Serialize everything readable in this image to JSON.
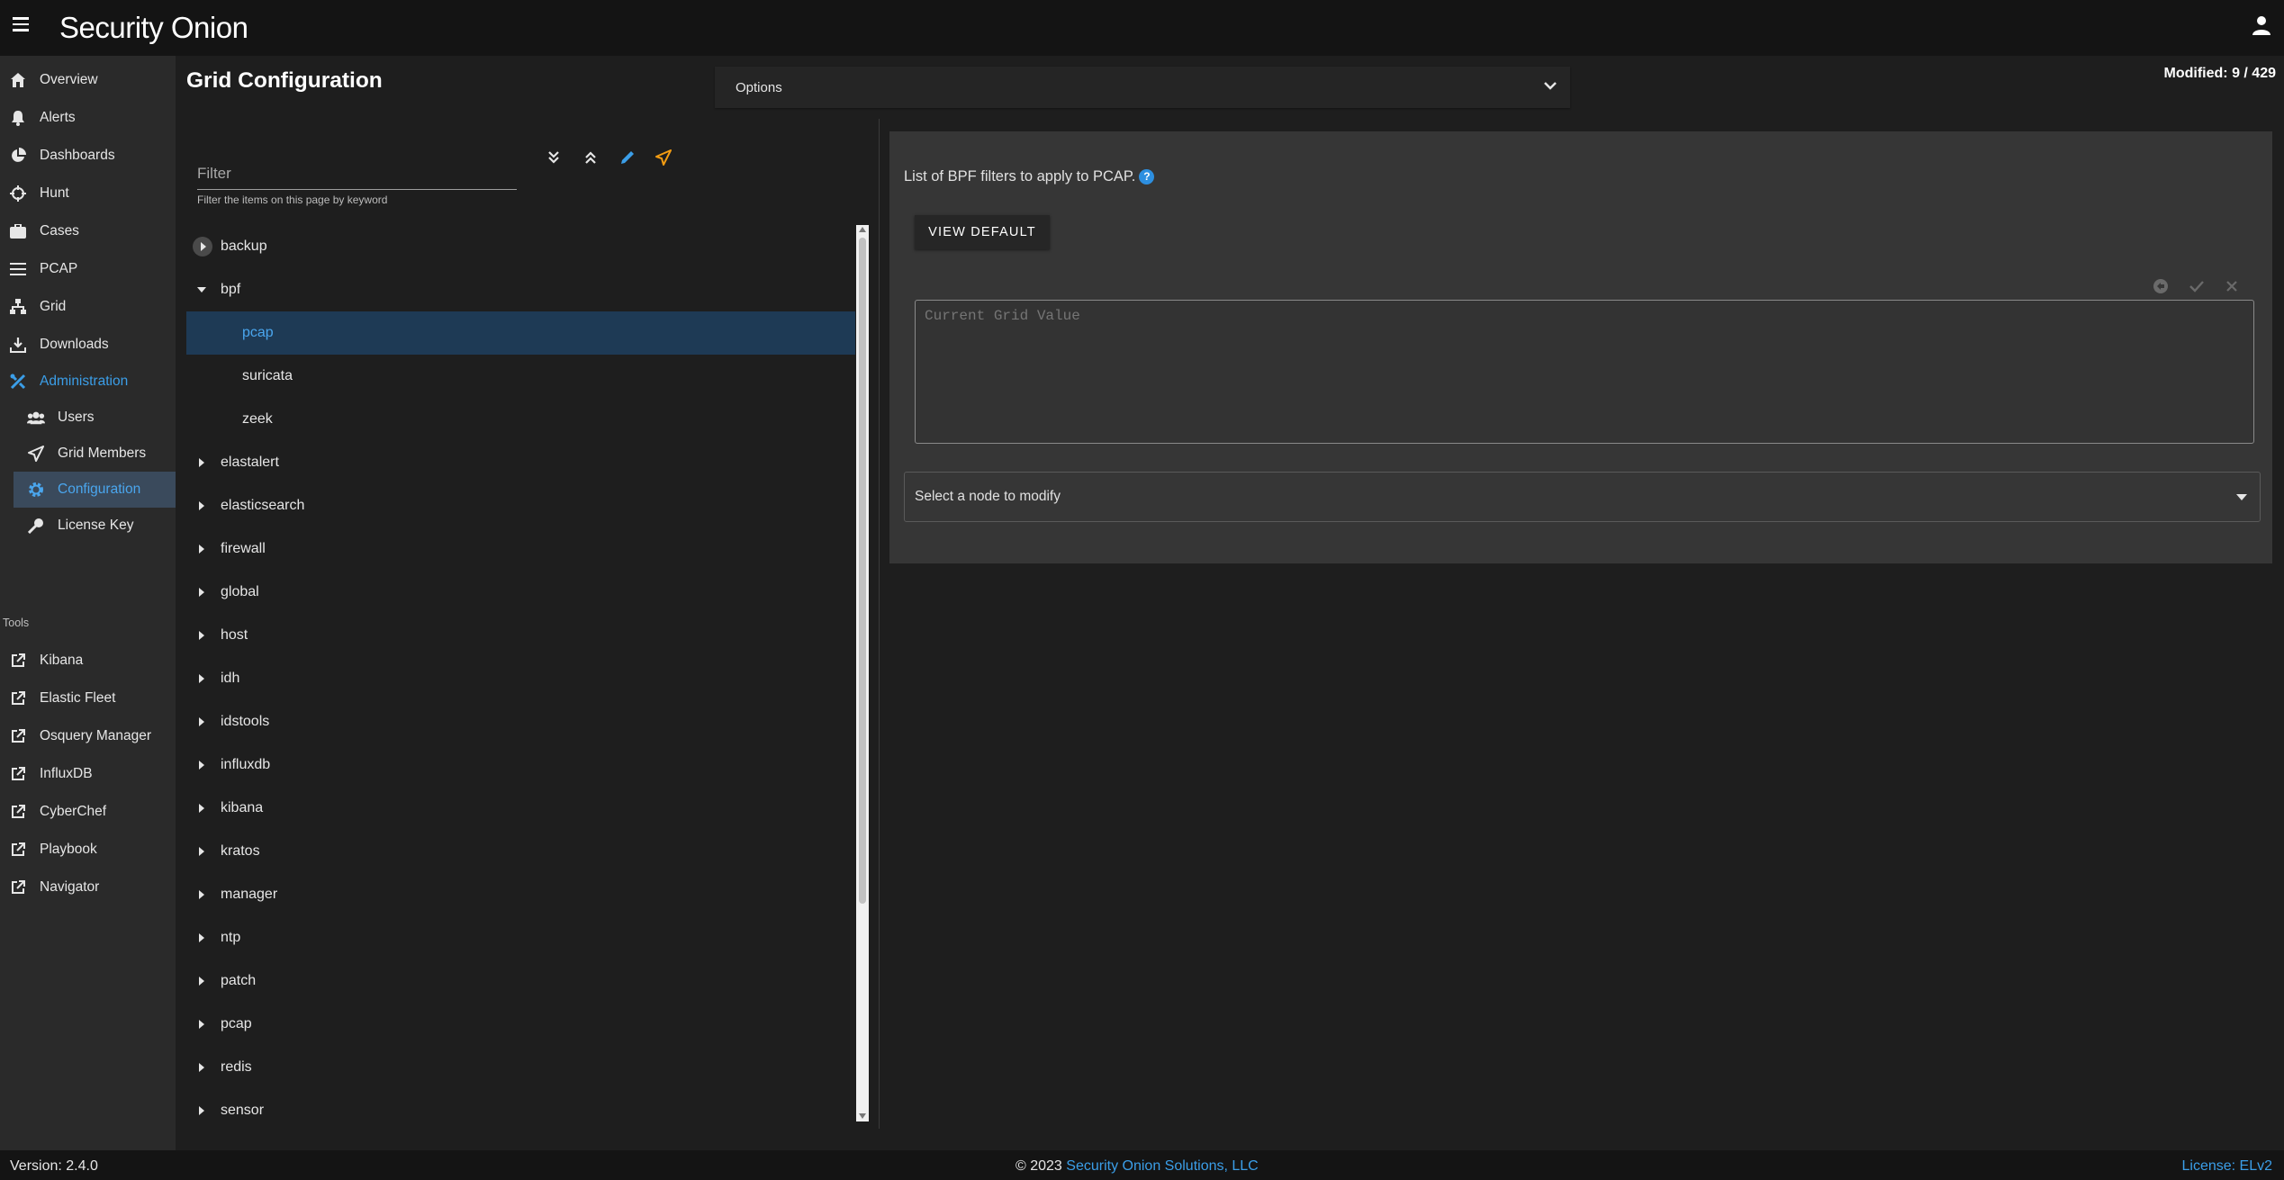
{
  "app": {
    "logo": "Security Onion"
  },
  "sidebar": {
    "items": [
      {
        "label": "Overview",
        "icon": "home-icon"
      },
      {
        "label": "Alerts",
        "icon": "bell-icon"
      },
      {
        "label": "Dashboards",
        "icon": "pie-chart-icon"
      },
      {
        "label": "Hunt",
        "icon": "crosshairs-icon"
      },
      {
        "label": "Cases",
        "icon": "briefcase-icon"
      },
      {
        "label": "PCAP",
        "icon": "lines-icon"
      },
      {
        "label": "Grid",
        "icon": "grid-network-icon"
      },
      {
        "label": "Downloads",
        "icon": "download-icon"
      },
      {
        "label": "Administration",
        "icon": "tools-icon"
      }
    ],
    "admin_items": [
      {
        "label": "Users",
        "icon": "users-icon"
      },
      {
        "label": "Grid Members",
        "icon": "send-icon"
      },
      {
        "label": "Configuration",
        "icon": "gear-icon"
      },
      {
        "label": "License Key",
        "icon": "key-icon"
      }
    ],
    "tools_heading": "Tools",
    "tools": [
      {
        "label": "Kibana"
      },
      {
        "label": "Elastic Fleet"
      },
      {
        "label": "Osquery Manager"
      },
      {
        "label": "InfluxDB"
      },
      {
        "label": "CyberChef"
      },
      {
        "label": "Playbook"
      },
      {
        "label": "Navigator"
      }
    ]
  },
  "header": {
    "title": "Grid Configuration",
    "options_label": "Options",
    "modified": "Modified: 9 / 429"
  },
  "filter": {
    "placeholder": "Filter",
    "hint": "Filter the items on this page by keyword"
  },
  "tree": {
    "items": [
      {
        "label": "backup"
      },
      {
        "label": "bpf"
      },
      {
        "label": "pcap"
      },
      {
        "label": "suricata"
      },
      {
        "label": "zeek"
      },
      {
        "label": "elastalert"
      },
      {
        "label": "elasticsearch"
      },
      {
        "label": "firewall"
      },
      {
        "label": "global"
      },
      {
        "label": "host"
      },
      {
        "label": "idh"
      },
      {
        "label": "idstools"
      },
      {
        "label": "influxdb"
      },
      {
        "label": "kibana"
      },
      {
        "label": "kratos"
      },
      {
        "label": "manager"
      },
      {
        "label": "ntp"
      },
      {
        "label": "patch"
      },
      {
        "label": "pcap"
      },
      {
        "label": "redis"
      },
      {
        "label": "sensor"
      }
    ]
  },
  "detail": {
    "description": "List of BPF filters to apply to PCAP.",
    "view_default": "VIEW DEFAULT",
    "value_placeholder": "Current Grid Value",
    "node_select": "Select a node to modify"
  },
  "footer": {
    "version": "Version: 2.4.0",
    "copyright": "© 2023",
    "company": "Security Onion Solutions, LLC",
    "license": "License: ELv2"
  },
  "colors": {
    "accent": "#3b9ee8",
    "selected_bg": "#1e3a55",
    "warning_icon": "#f39c12"
  }
}
